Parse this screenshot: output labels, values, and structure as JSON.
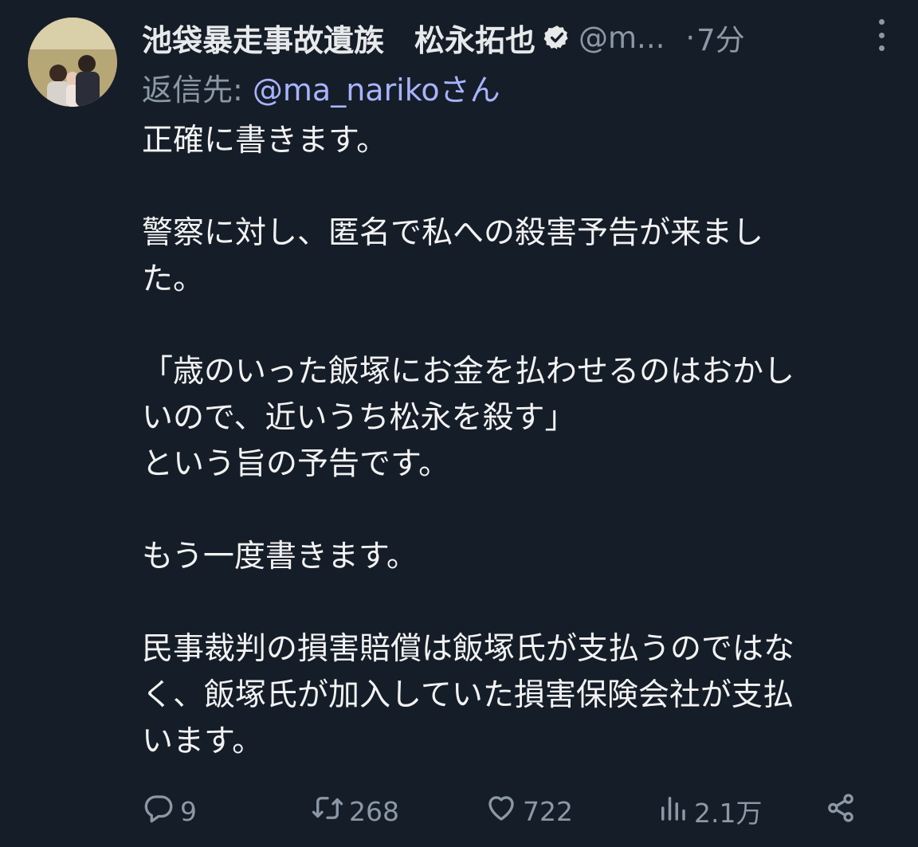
{
  "author": {
    "display_name": "池袋暴走事故遺族　松永拓也",
    "handle": "@m...",
    "separator": "·",
    "time": "7分",
    "avatar_icon": "profile-photo",
    "verified_icon": "verified-badge-icon"
  },
  "reply": {
    "prefix": "返信先: ",
    "mention": "@ma_nariko",
    "suffix": "さん"
  },
  "tweet": {
    "paragraphs": [
      "正確に書きます。",
      "",
      "警察に対し、匿名で私への殺害予告が来まし\nた。",
      "",
      "「歳のいった飯塚にお金を払わせるのはおかし\nいので、近いうち松永を殺す」\nという旨の予告です。",
      "",
      "もう一度書きます。",
      "",
      "民事裁判の損害賠償は飯塚氏が支払うのではな\nく、飯塚氏が加入していた損害保険会社が支払\nいます。"
    ]
  },
  "actions": {
    "reply": {
      "icon": "reply-icon",
      "count": "9"
    },
    "retweet": {
      "icon": "retweet-icon",
      "count": "268"
    },
    "like": {
      "icon": "heart-icon",
      "count": "722"
    },
    "views": {
      "icon": "views-icon",
      "count": "2.1万"
    },
    "share": {
      "icon": "share-icon"
    }
  },
  "colors": {
    "background": "#151d28",
    "text": "#e7e9ea",
    "muted": "#8b98a5",
    "mention": "#a8b4ff"
  }
}
